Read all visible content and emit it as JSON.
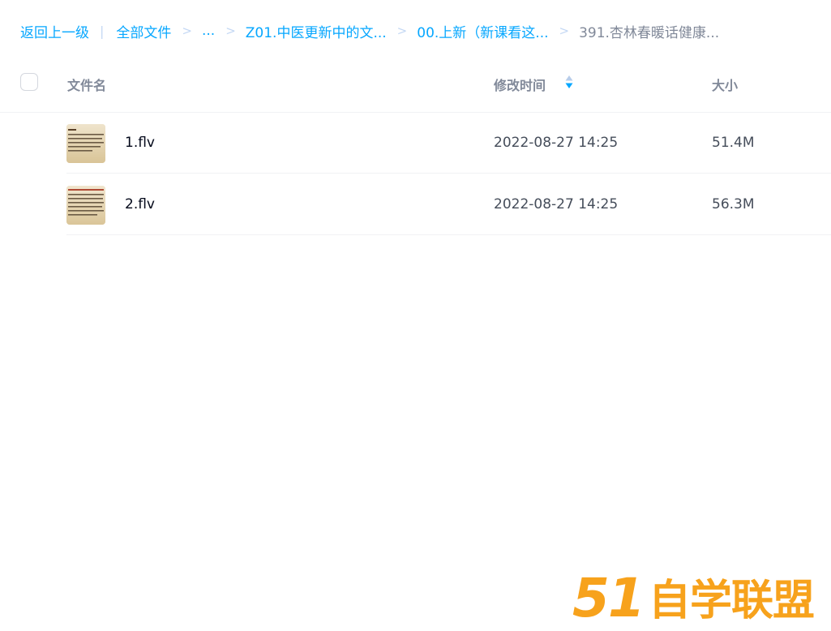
{
  "breadcrumb": {
    "back": "返回上一级",
    "all_files": "全部文件",
    "ellipsis": "...",
    "level1": "Z01.中医更新中的文...",
    "level2": "00.上新（新课看这...",
    "current": "391.杏林春暖话健康..."
  },
  "columns": {
    "name": "文件名",
    "modified": "修改时间",
    "size": "大小"
  },
  "files": [
    {
      "name": "1.flv",
      "modified": "2022-08-27 14:25",
      "size": "51.4M"
    },
    {
      "name": "2.flv",
      "modified": "2022-08-27 14:25",
      "size": "56.3M"
    }
  ],
  "colors": {
    "accent": "#06a7ff",
    "watermark": "#f7a21c"
  },
  "watermark": "51自学联盟"
}
